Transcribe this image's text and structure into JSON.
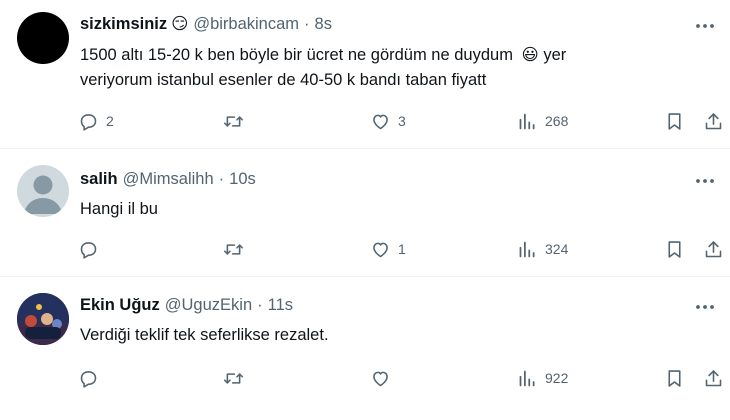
{
  "tweets": [
    {
      "name": "sizkimsiniz",
      "name_emoji": "😏",
      "handle": "@birbakincam",
      "separator": "·",
      "time": "8s",
      "text_line1": "1500 altı 15-20 k ben böyle bir ücret ne gördüm ne duydum",
      "text_emoji": "😃",
      "text_line1_end": "yer",
      "text_line2": "veriyorum istanbul esenler de 40-50 k bandı taban fiyatt",
      "replies": "2",
      "retweets": "",
      "likes": "3",
      "views": "268"
    },
    {
      "name": "salih",
      "handle": "@Mimsalihh",
      "separator": "·",
      "time": "10s",
      "text": "Hangi il bu",
      "replies": "",
      "retweets": "",
      "likes": "1",
      "views": "324"
    },
    {
      "name": "Ekin Uğuz",
      "handle": "@UguzEkin",
      "separator": "·",
      "time": "11s",
      "text": "Verdiği teklif tek seferlikse rezalet.",
      "replies": "",
      "retweets": "",
      "likes": "",
      "views": "922"
    }
  ],
  "icons": [
    "more-icon",
    "reply-icon",
    "retweet-icon",
    "like-icon",
    "views-icon",
    "bookmark-icon",
    "share-icon"
  ],
  "colors": {
    "text": "#0f1419",
    "secondary": "#536471",
    "divider": "#eff3f4",
    "emoji": "#ffcc33"
  }
}
